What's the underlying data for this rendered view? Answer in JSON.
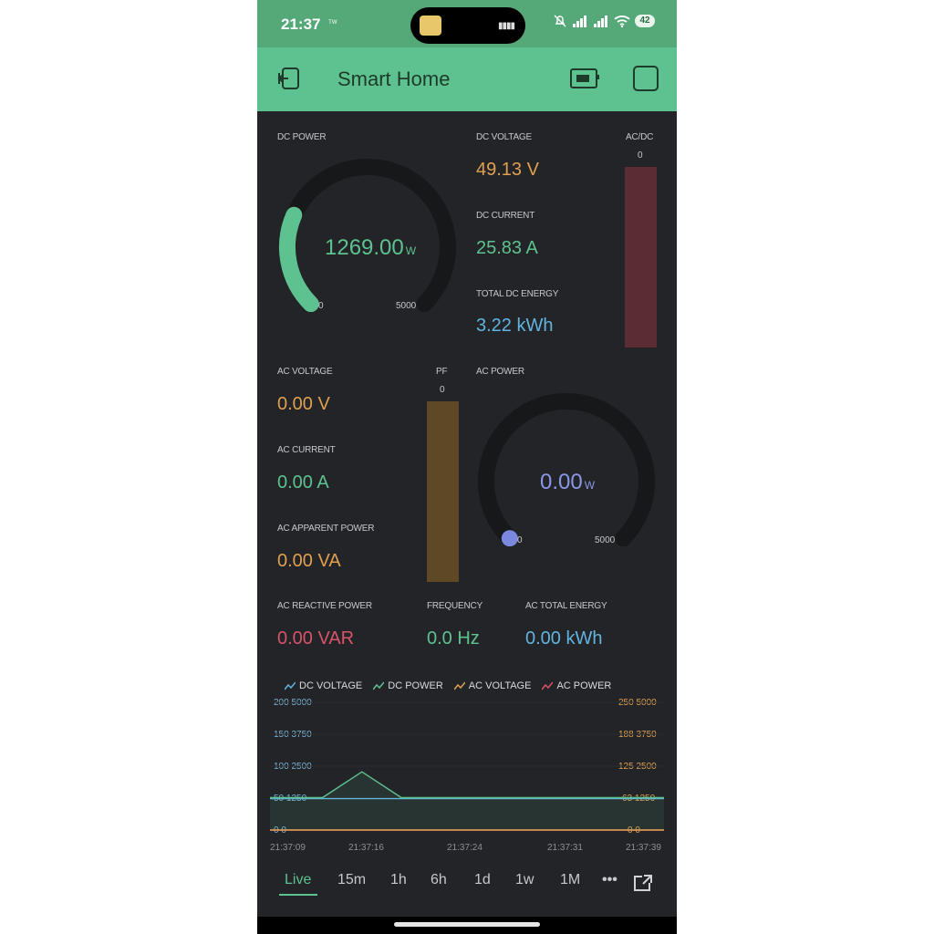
{
  "status_bar": {
    "time": "21:37",
    "extra": "ᵀᵂ",
    "battery": "42"
  },
  "app": {
    "title": "Smart Home"
  },
  "dc": {
    "power": {
      "label": "DC POWER",
      "value": "1269.00",
      "unit": "W",
      "min": "0",
      "max": "5000",
      "fraction": 0.254
    },
    "voltage": {
      "label": "DC VOLTAGE",
      "value": "49.13 V"
    },
    "current": {
      "label": "DC CURRENT",
      "value": "25.83 A"
    },
    "energy": {
      "label": "TOTAL DC ENERGY",
      "value": "3.22 kWh"
    },
    "acdc": {
      "label": "AC/DC",
      "value": "0",
      "fraction": 0
    }
  },
  "ac": {
    "voltage": {
      "label": "AC VOLTAGE",
      "value": "0.00 V"
    },
    "current": {
      "label": "AC CURRENT",
      "value": "0.00 A"
    },
    "apparent": {
      "label": "AC APPARENT POWER",
      "value": "0.00 VA"
    },
    "pf": {
      "label": "PF",
      "value": "0",
      "fraction": 0
    },
    "power": {
      "label": "AC POWER",
      "value": "0.00",
      "unit": "W",
      "min": "0",
      "max": "5000",
      "fraction": 0
    },
    "reactive": {
      "label": "AC REACTIVE POWER",
      "value": "0.00 VAR"
    },
    "frequency": {
      "label": "FREQUENCY",
      "value": "0.0 Hz"
    },
    "energy": {
      "label": "AC TOTAL ENERGY",
      "value": "0.00 kWh"
    }
  },
  "chart": {
    "legend": [
      "DC VOLTAGE",
      "DC POWER",
      "AC VOLTAGE",
      "AC POWER"
    ],
    "left_ticks": [
      "200 5000",
      "150 3750",
      "100 2500",
      "50 1250",
      "0 0"
    ],
    "right_ticks": [
      "250 5000",
      "188 3750",
      "125 2500",
      "63 1250",
      "0 0"
    ],
    "x_ticks": [
      "21:37:09",
      "21:37:16",
      "21:37:24",
      "21:37:31",
      "21:37:39"
    ]
  },
  "chart_data": {
    "type": "line",
    "x": [
      "21:37:09",
      "21:37:13",
      "21:37:16",
      "21:37:19",
      "21:37:24",
      "21:37:31",
      "21:37:39"
    ],
    "series": [
      {
        "name": "DC VOLTAGE",
        "values": [
          49.1,
          49.1,
          49.1,
          49.1,
          49.1,
          49.1,
          49.1
        ]
      },
      {
        "name": "DC POWER",
        "values": [
          1269,
          1269,
          2280,
          1269,
          1269,
          1269,
          1269
        ]
      },
      {
        "name": "AC VOLTAGE",
        "values": [
          0,
          0,
          0,
          0,
          0,
          0,
          0
        ]
      },
      {
        "name": "AC POWER",
        "values": [
          0,
          0,
          0,
          0,
          0,
          0,
          0
        ]
      }
    ],
    "y_left_ticks": [
      "0 0",
      "50 1250",
      "100 2500",
      "150 3750",
      "200 5000"
    ],
    "y_right_ticks": [
      "0 0",
      "63 1250",
      "125 2500",
      "188 3750",
      "250 5000"
    ],
    "ylim_left": [
      0,
      200
    ],
    "ylim_power": [
      0,
      5000
    ],
    "ylim_right": [
      0,
      250
    ],
    "legend": "top"
  },
  "time_ranges": [
    "Live",
    "15m",
    "1h",
    "6h",
    "1d",
    "1w",
    "1M"
  ],
  "colors": {
    "status_bar": "#55a878",
    "app_bar": "#5ec290",
    "background": "#222427",
    "green": "#5ec290",
    "orange": "#e0a050",
    "blue": "#62b4e0",
    "purple": "#8a97e6",
    "red": "#d9536a",
    "acdc_bar": "#5b2c34",
    "pf_bar": "#5f4826"
  }
}
